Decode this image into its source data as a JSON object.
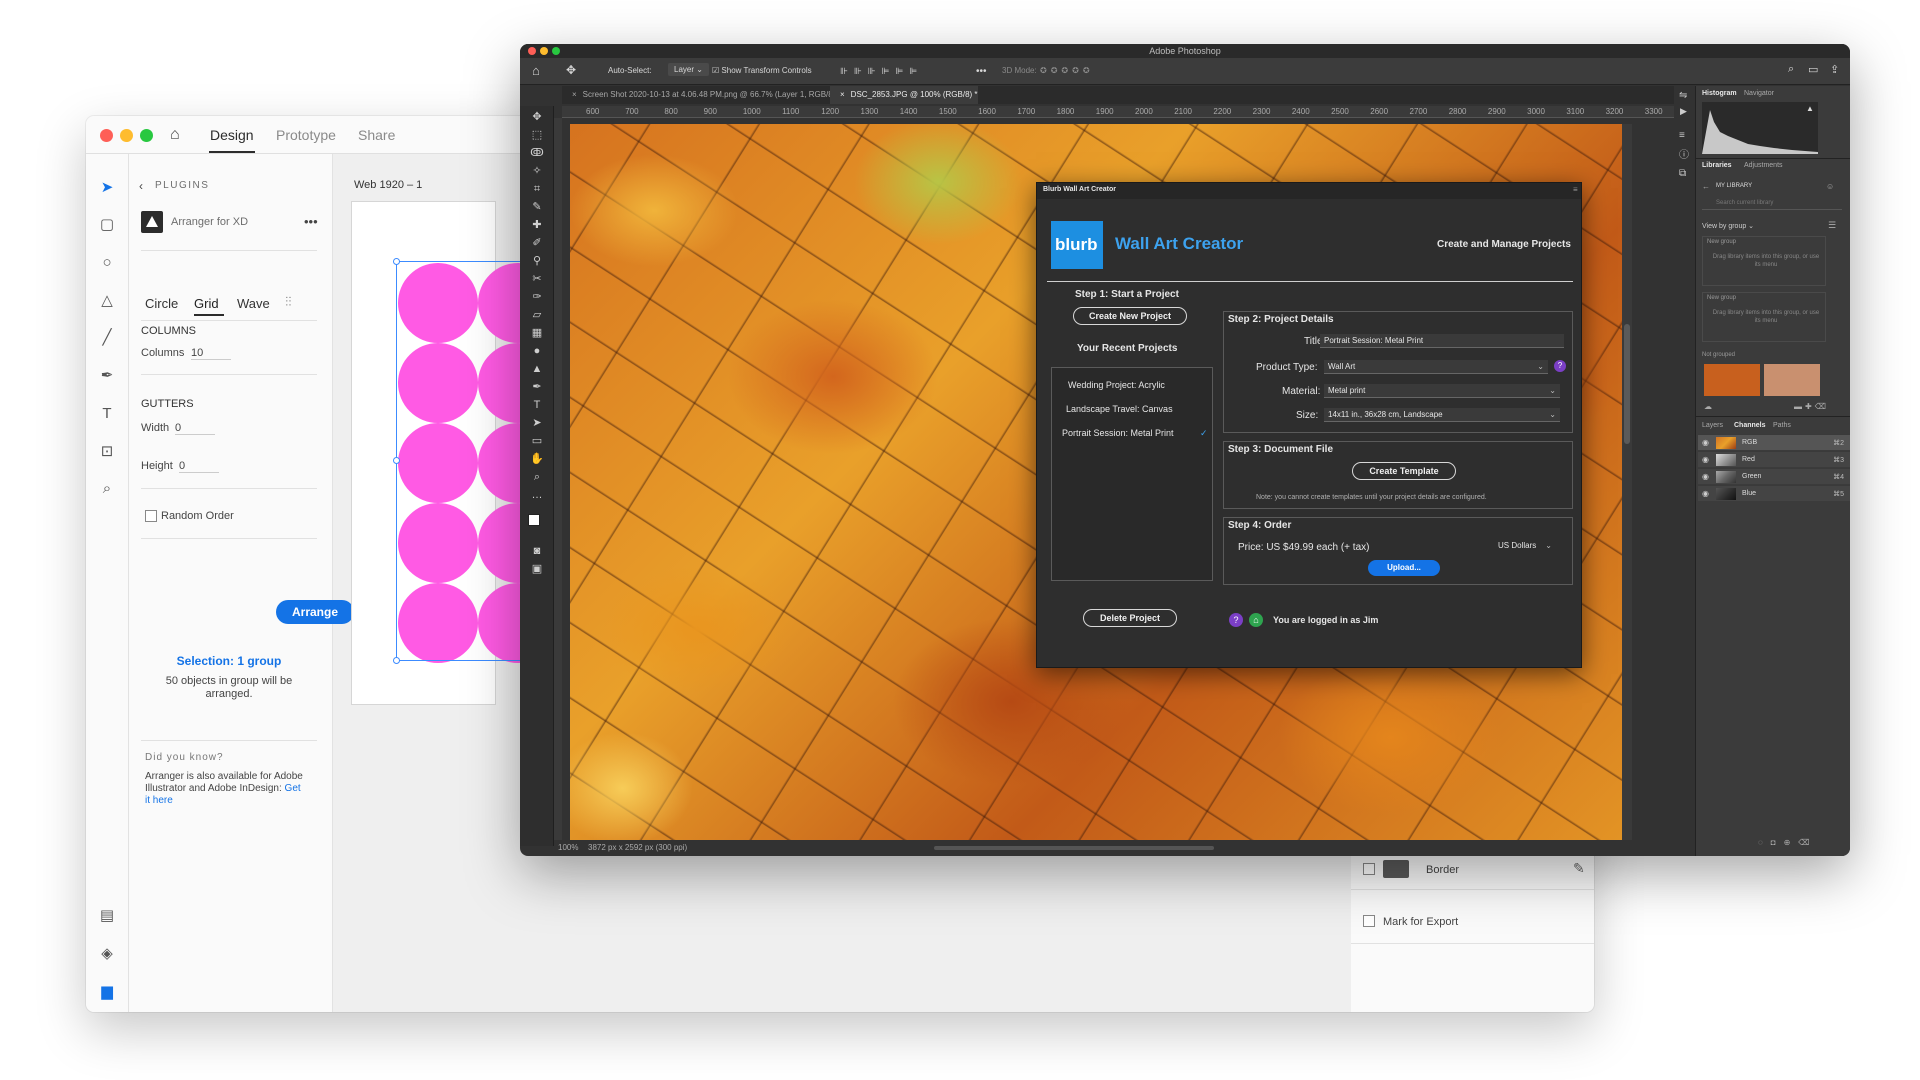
{
  "xd": {
    "tabs": [
      "Design",
      "Prototype",
      "Share"
    ],
    "plugins_label": "PLUGINS",
    "plugin_name": "Arranger for XD",
    "more": "•••",
    "modes": [
      "Circle",
      "Grid",
      "Wave"
    ],
    "columns_heading": "COLUMNS",
    "columns_label": "Columns",
    "columns_value": "10",
    "gutters_heading": "GUTTERS",
    "width_label": "Width",
    "width_value": "0",
    "height_label": "Height",
    "height_value": "0",
    "random_order": "Random Order",
    "arrange_button": "Arrange",
    "selection_title": "Selection: 1 group",
    "selection_desc": "50 objects in group will be arranged.",
    "did_you_know": "Did you know?",
    "tip_text": "Arranger is also available for Adobe Illustrator and Adobe InDesign:",
    "tip_link": "Get it here",
    "artboard_name": "Web 1920 – 1",
    "border_label": "Border",
    "mark_export_label": "Mark for Export"
  },
  "ps": {
    "app_title": "Adobe Photoshop",
    "auto_select": "Auto-Select:",
    "layer_dropdown": "Layer",
    "show_transform": "Show Transform Controls",
    "mode_3d": "3D Mode:",
    "doc_tabs": [
      "Screen Shot 2020-10-13 at 4.06.48 PM.png @ 66.7% (Layer 1, RGB/8*)",
      "DSC_2853.JPG @ 100% (RGB/8) *"
    ],
    "ruler": [
      "600",
      "700",
      "800",
      "900",
      "1000",
      "1100",
      "1200",
      "1300",
      "1400",
      "1500",
      "1600",
      "1700",
      "1800",
      "1900",
      "2000",
      "2100",
      "2200",
      "2300",
      "2400",
      "2500",
      "2600",
      "2700",
      "2800",
      "2900",
      "3000",
      "3100",
      "3200",
      "3300"
    ],
    "zoom": "100%",
    "doc_info": "3872 px x 2592 px (300 ppi)",
    "panel_tabs_top": [
      "Histogram",
      "Navigator"
    ],
    "panel_tabs_lib": [
      "Libraries",
      "Adjustments"
    ],
    "my_library": "MY LIBRARY",
    "search_placeholder": "Search current library",
    "view_by": "View by group",
    "new_group": "New group",
    "drag_hint": "Drag library items into this group, or use its menu",
    "not_grouped": "Not grouped",
    "swatch_colors": [
      "#c8601e",
      "#c9906f"
    ],
    "panel_tabs_bottom": [
      "Layers",
      "Channels",
      "Paths"
    ],
    "channels": [
      {
        "name": "RGB",
        "key": "⌘2"
      },
      {
        "name": "Red",
        "key": "⌘3"
      },
      {
        "name": "Green",
        "key": "⌘4"
      },
      {
        "name": "Blue",
        "key": "⌘5"
      }
    ]
  },
  "blurb": {
    "window_title": "Blurb Wall Art Creator",
    "logo": "blurb",
    "product": "Wall Art Creator",
    "tagline": "Create and Manage Projects",
    "step1": "Step 1: Start a Project",
    "create_new": "Create New Project",
    "recent": "Your Recent Projects",
    "projects": [
      "Wedding Project: Acrylic",
      "Landscape Travel: Canvas",
      "Portrait Session: Metal Print"
    ],
    "check": "✓",
    "delete": "Delete Project",
    "step2": "Step 2: Project Details",
    "title_label": "Title:",
    "title_value": "Portrait Session: Metal Print",
    "product_type_label": "Product Type:",
    "product_type_value": "Wall Art",
    "material_label": "Material:",
    "material_value": "Metal print",
    "size_label": "Size:",
    "size_value": "14x11 in., 36x28 cm, Landscape",
    "help": "?",
    "step3": "Step 3: Document File",
    "create_template": "Create Template",
    "note": "Note: you cannot create templates until your project details are configured.",
    "step4": "Step 4: Order",
    "price": "Price:  US $49.99 each (+ tax)",
    "currency": "US Dollars",
    "upload": "Upload...",
    "logged_in": "You are logged in as Jim",
    "accent": "#1473e6",
    "logo_color": "#1d8fe1"
  }
}
